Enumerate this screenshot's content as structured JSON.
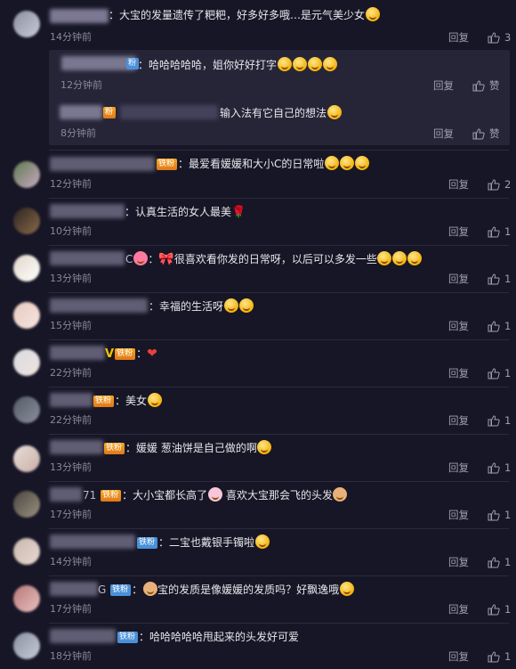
{
  "ui": {
    "reply_label": "回复",
    "like_label": "赞",
    "accent": "#f6a623",
    "badge_blue": "#4a90d9"
  },
  "comments": [
    {
      "text": "：大宝的发量遗传了粑粑，好多好多哦…是元气美少女",
      "time": "14分钟前",
      "likes": "3"
    },
    {
      "text": "：哈哈哈哈哈，姐你好好打字",
      "time": "12分钟前",
      "likes": "赞"
    },
    {
      "text": "输入法有它自己的想法",
      "time": "8分钟前",
      "likes": "赞"
    },
    {
      "badge": "铁粉",
      "text": "：最爱看媛媛和大小C的日常啦",
      "time": "12分钟前",
      "likes": "2"
    },
    {
      "text": "：认真生活的女人最美",
      "time": "10分钟前",
      "likes": "1"
    },
    {
      "prefix": "C",
      "text": "很喜欢看你发的日常呀，以后可以多发一些",
      "time": "13分钟前",
      "likes": "1"
    },
    {
      "text": "：幸福的生活呀",
      "time": "15分钟前",
      "likes": "1"
    },
    {
      "prefix": "V",
      "badge": "铁粉",
      "text": "：",
      "time": "22分钟前",
      "likes": "1"
    },
    {
      "badge": "铁粉",
      "text": "：美女",
      "time": "22分钟前",
      "likes": "1"
    },
    {
      "badge": "铁粉",
      "text": "：媛媛 葱油饼是自己做的啊",
      "time": "13分钟前",
      "likes": "1"
    },
    {
      "prefix": "71",
      "badge": "铁粉",
      "text": "：大小宝都长高了",
      "text2": "喜欢大宝那会飞的头发",
      "time": "17分钟前",
      "likes": "1"
    },
    {
      "badge": "铁粉",
      "text": "：二宝也戴银手镯啦",
      "time": "14分钟前",
      "likes": "1"
    },
    {
      "prefix": "G",
      "badge": "铁粉",
      "text": "宝的发质是像媛媛的发质吗？好飘逸哦",
      "time": "17分钟前",
      "likes": "1"
    },
    {
      "badge": "铁粉",
      "text": "：哈哈哈哈哈甩起来的头发好可爱",
      "time": "18分钟前",
      "likes": "1"
    }
  ]
}
